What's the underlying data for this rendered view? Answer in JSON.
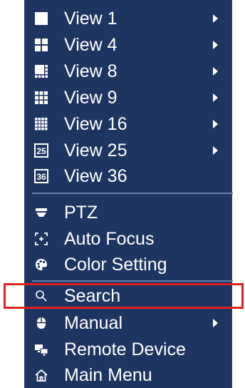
{
  "menu": {
    "items": [
      {
        "label": "View 1",
        "icon": "view-1-icon",
        "has_submenu": true
      },
      {
        "label": "View 4",
        "icon": "view-4-icon",
        "has_submenu": true
      },
      {
        "label": "View 8",
        "icon": "view-8-icon",
        "has_submenu": true
      },
      {
        "label": "View 9",
        "icon": "view-9-icon",
        "has_submenu": true
      },
      {
        "label": "View 16",
        "icon": "view-16-icon",
        "has_submenu": true
      },
      {
        "label": "View 25",
        "icon": "view-25-icon",
        "icon_text": "25",
        "has_submenu": true
      },
      {
        "label": "View 36",
        "icon": "view-36-icon",
        "icon_text": "36",
        "has_submenu": false
      },
      {
        "label": "PTZ",
        "icon": "ptz-icon",
        "has_submenu": false
      },
      {
        "label": "Auto Focus",
        "icon": "auto-focus-icon",
        "has_submenu": false
      },
      {
        "label": "Color Setting",
        "icon": "color-palette-icon",
        "has_submenu": false
      },
      {
        "label": "Search",
        "icon": "search-icon",
        "has_submenu": false,
        "highlighted": true
      },
      {
        "label": "Manual",
        "icon": "mouse-icon",
        "has_submenu": true
      },
      {
        "label": "Remote Device",
        "icon": "remote-device-icon",
        "has_submenu": false
      },
      {
        "label": "Main Menu",
        "icon": "home-icon",
        "has_submenu": false
      }
    ]
  },
  "colors": {
    "menu_background": "#1f3561",
    "text": "#ffffff",
    "divider": "#6a7fa6",
    "highlight_border": "#e02020"
  }
}
